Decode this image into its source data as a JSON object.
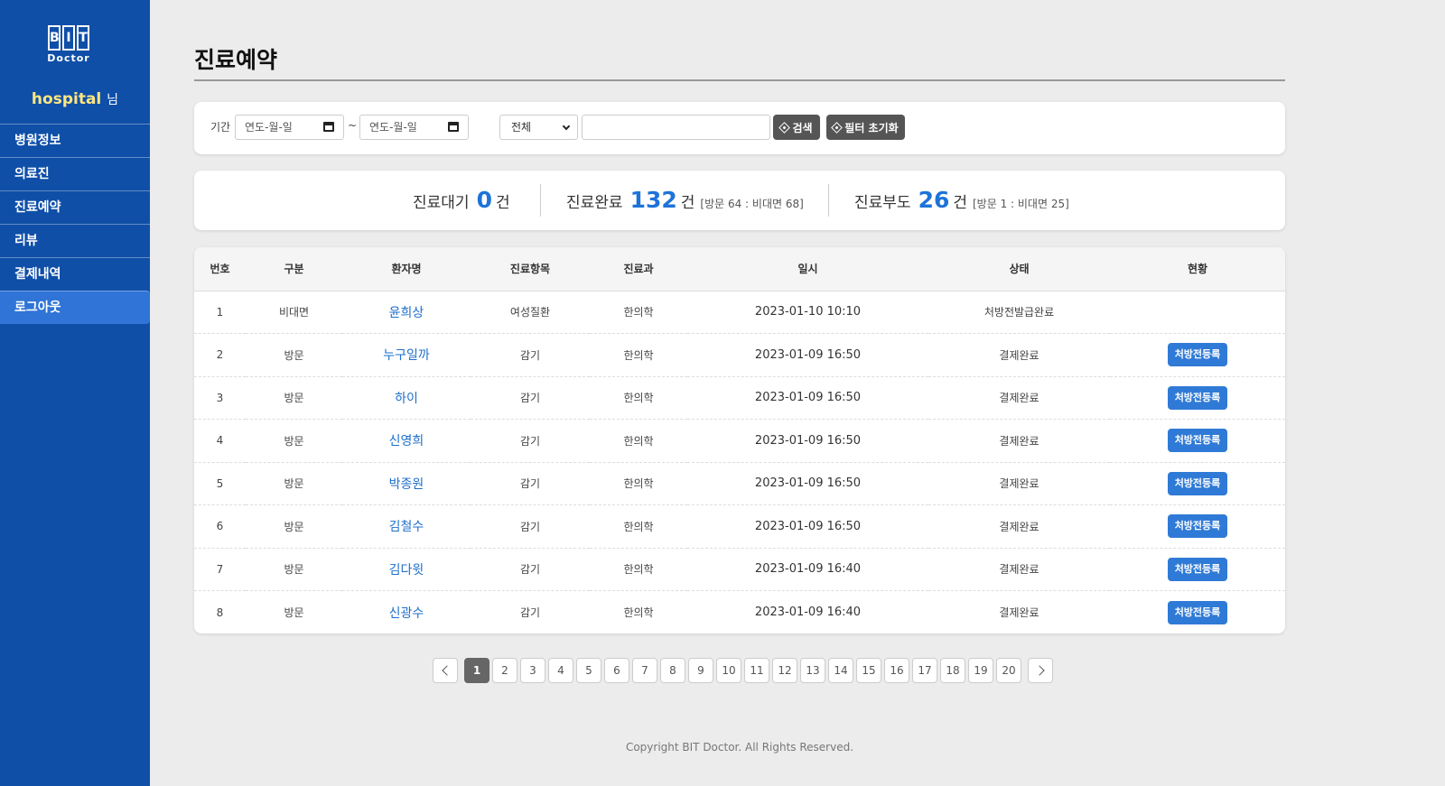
{
  "sidebar": {
    "logo": {
      "letters": [
        "B",
        "I",
        "T"
      ],
      "sub": "Doctor"
    },
    "user": {
      "name": "hospital",
      "suffix": "님"
    },
    "items": [
      {
        "label": "병원정보"
      },
      {
        "label": "의료진"
      },
      {
        "label": "진료예약"
      },
      {
        "label": "리뷰"
      },
      {
        "label": "결제내역"
      },
      {
        "label": "로그아웃",
        "active": true
      }
    ]
  },
  "header": {
    "title": "진료예약"
  },
  "filter": {
    "period_label": "기간",
    "date_from_placeholder": "연도-월-일",
    "date_to_placeholder": "연도-월-일",
    "tilde": "~",
    "select_value": "전체",
    "search_value": "",
    "search_button": "검색",
    "reset_button": "필터 초기화"
  },
  "stats": {
    "waiting": {
      "label": "진료대기",
      "count": "0",
      "unit": "건"
    },
    "done": {
      "label": "진료완료",
      "count": "132",
      "unit": "건",
      "detail": "[방문 64 : 비대면 68]"
    },
    "absent": {
      "label": "진료부도",
      "count": "26",
      "unit": "건",
      "detail": "[방문 1 : 비대면 25]"
    }
  },
  "table": {
    "headers": [
      "번호",
      "구분",
      "환자명",
      "진료항목",
      "진료과",
      "일시",
      "상태",
      "현황"
    ],
    "rows": [
      {
        "no": "1",
        "type": "비대면",
        "patient": "윤희상",
        "item": "여성질환",
        "dept": "한의학",
        "datetime": "2023-01-10 10:10",
        "status": "처방전발급완료",
        "action": ""
      },
      {
        "no": "2",
        "type": "방문",
        "patient": "누구일까",
        "item": "감기",
        "dept": "한의학",
        "datetime": "2023-01-09 16:50",
        "status": "결제완료",
        "action": "처방전등록"
      },
      {
        "no": "3",
        "type": "방문",
        "patient": "하이",
        "item": "감기",
        "dept": "한의학",
        "datetime": "2023-01-09 16:50",
        "status": "결제완료",
        "action": "처방전등록"
      },
      {
        "no": "4",
        "type": "방문",
        "patient": "신영희",
        "item": "감기",
        "dept": "한의학",
        "datetime": "2023-01-09 16:50",
        "status": "결제완료",
        "action": "처방전등록"
      },
      {
        "no": "5",
        "type": "방문",
        "patient": "박종원",
        "item": "감기",
        "dept": "한의학",
        "datetime": "2023-01-09 16:50",
        "status": "결제완료",
        "action": "처방전등록"
      },
      {
        "no": "6",
        "type": "방문",
        "patient": "김철수",
        "item": "감기",
        "dept": "한의학",
        "datetime": "2023-01-09 16:50",
        "status": "결제완료",
        "action": "처방전등록"
      },
      {
        "no": "7",
        "type": "방문",
        "patient": "김다윗",
        "item": "감기",
        "dept": "한의학",
        "datetime": "2023-01-09 16:40",
        "status": "결제완료",
        "action": "처방전등록"
      },
      {
        "no": "8",
        "type": "방문",
        "patient": "신광수",
        "item": "감기",
        "dept": "한의학",
        "datetime": "2023-01-09 16:40",
        "status": "결제완료",
        "action": "처방전등록"
      }
    ]
  },
  "pagination": {
    "current": "1",
    "pages": [
      "1",
      "2",
      "3",
      "4",
      "5",
      "6",
      "7",
      "8",
      "9",
      "10",
      "11",
      "12",
      "13",
      "14",
      "15",
      "16",
      "17",
      "18",
      "19",
      "20"
    ]
  },
  "footer": {
    "copyright": "Copyright BIT Doctor. All Rights Reserved."
  },
  "colors": {
    "sidebar": "#0f4fa8",
    "accent": "#1e73d8",
    "button": "#2f7ad6",
    "dark_button": "#555555"
  }
}
